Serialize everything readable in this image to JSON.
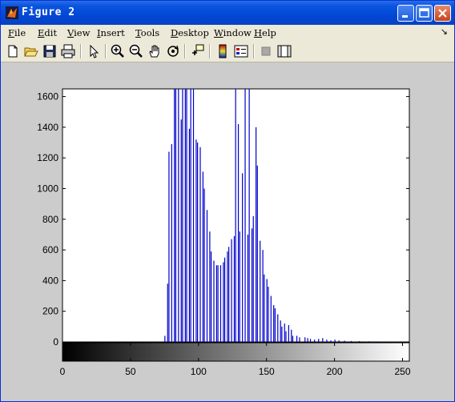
{
  "window": {
    "title": "Figure 2"
  },
  "menu": [
    "File",
    "Edit",
    "View",
    "Insert",
    "Tools",
    "Desktop",
    "Window",
    "Help"
  ],
  "menu_arrow": "↘",
  "icons": [
    "new-file-icon",
    "open-folder-icon",
    "save-icon",
    "print-icon",
    "select-arrow-icon",
    "zoom-in-icon",
    "zoom-out-icon",
    "pan-hand-icon",
    "rotate-3d-icon",
    "data-cursor-icon",
    "colorbar-icon",
    "legend-icon",
    "hide-plot-tools-icon",
    "show-plot-tools-icon"
  ],
  "colors": {
    "bars": "#0000cc",
    "titlebar": "#0a55e0",
    "figure_bg": "#cccccc"
  },
  "chart_data": {
    "type": "bar",
    "title": "",
    "xlabel": "",
    "ylabel": "",
    "xlim": [
      0,
      255
    ],
    "ylim": [
      0,
      1650
    ],
    "yticks": [
      "0",
      "200",
      "400",
      "600",
      "800",
      "1000",
      "1200",
      "1400",
      "1600"
    ],
    "xticks": [
      "0",
      "50",
      "100",
      "150",
      "200",
      "250"
    ],
    "series": [
      {
        "x": [
          75,
          76,
          77,
          78,
          79,
          80,
          81,
          82,
          83,
          84,
          85,
          86,
          87,
          88,
          89,
          90,
          91,
          92,
          93,
          94,
          95,
          96,
          97,
          98,
          99,
          100,
          101,
          102,
          103,
          104,
          105,
          106,
          107,
          108,
          109,
          110,
          111,
          112,
          113,
          114,
          115,
          116,
          117,
          118,
          119,
          120,
          121,
          122,
          123,
          124,
          125,
          126,
          127,
          128,
          129,
          130,
          131,
          132,
          133,
          134,
          135,
          136,
          137,
          138,
          139,
          140,
          141,
          142,
          143,
          144,
          145,
          146,
          147,
          148,
          149,
          150,
          151,
          152,
          153,
          154,
          155,
          156,
          157,
          158,
          159,
          160,
          161,
          162,
          163,
          164,
          165,
          166,
          167,
          168,
          169,
          170,
          172,
          174,
          176,
          178,
          180,
          182,
          185,
          188,
          191,
          194,
          197,
          200,
          203,
          207,
          212,
          218,
          225,
          232,
          240,
          250
        ],
        "values": [
          40,
          0,
          380,
          1240,
          0,
          1290,
          0,
          1650,
          1650,
          0,
          1650,
          0,
          1450,
          1650,
          0,
          1650,
          1650,
          0,
          1390,
          1650,
          0,
          1650,
          0,
          1320,
          1300,
          0,
          1270,
          0,
          1110,
          1000,
          0,
          860,
          0,
          720,
          590,
          0,
          530,
          0,
          500,
          500,
          0,
          500,
          0,
          520,
          550,
          0,
          590,
          620,
          0,
          670,
          0,
          690,
          1650,
          0,
          1420,
          720,
          0,
          1100,
          0,
          1650,
          0,
          700,
          1650,
          0,
          740,
          820,
          0,
          1400,
          1150,
          0,
          660,
          0,
          600,
          440,
          0,
          410,
          360,
          0,
          300,
          0,
          240,
          220,
          0,
          180,
          0,
          140,
          100,
          0,
          120,
          70,
          0,
          110,
          0,
          80,
          40,
          0,
          40,
          30,
          0,
          30,
          25,
          20,
          15,
          20,
          25,
          15,
          10,
          15,
          10,
          8,
          6,
          5,
          4,
          3,
          2,
          1
        ]
      }
    ],
    "colorbar": {
      "orientation": "horizontal",
      "from": "#000000",
      "to": "#ffffff"
    }
  }
}
